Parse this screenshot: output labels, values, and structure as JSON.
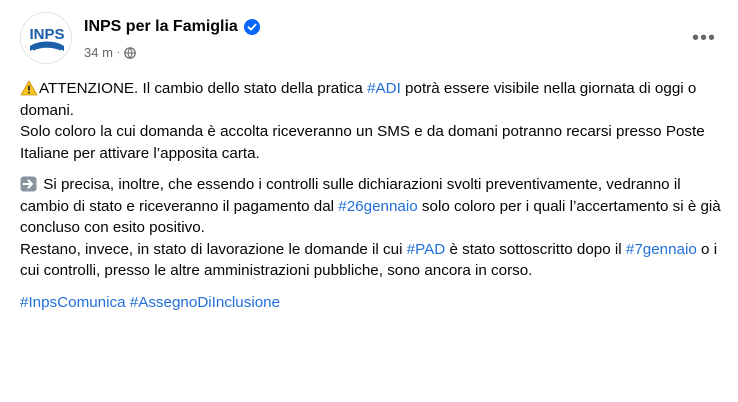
{
  "header": {
    "avatar_text": "INPS",
    "author": "INPS per la Famiglia",
    "time": "34 m",
    "dot": "·",
    "more": "•••"
  },
  "post": {
    "p1": {
      "t1": "ATTENZIONE. Il cambio dello stato della pratica ",
      "h1": "#ADI",
      "t2": " potrà essere visibile nella giornata di oggi o domani.",
      "t3": "Solo coloro la cui domanda è accolta riceveranno un SMS e da domani potranno recarsi presso Poste Italiane per attivare l’apposita carta."
    },
    "p2": {
      "t1": " Si precisa, inoltre, che essendo i controlli sulle dichiarazioni svolti preventivamente,  vedranno il cambio di stato e riceveranno il pagamento dal ",
      "h1": "#26gennaio",
      "t2": " solo coloro per i quali l’accertamento si è già concluso con esito positivo.",
      "t3": "Restano, invece, in stato di lavorazione le domande il cui ",
      "h2": "#PAD",
      "t4": " è stato sottoscritto dopo il ",
      "h3": "#7gennaio",
      "t5": " o i cui controlli, presso le altre amministrazioni pubbliche, sono ancora in corso."
    },
    "tags": {
      "h1": "#InpsComunica",
      "h2": "#AssegnoDiInclusione"
    }
  },
  "colors": {
    "hashtag": "#216fdb",
    "verified": "#0866ff",
    "secondary_text": "#65676b",
    "inps_blue": "#1a5fa8"
  },
  "icons": {
    "avatar": "inps-logo",
    "verified": "verified-badge-icon",
    "privacy": "globe-icon",
    "more": "more-options-icon",
    "warning": "warning-emoji-icon",
    "arrow": "right-arrow-emoji-icon"
  }
}
